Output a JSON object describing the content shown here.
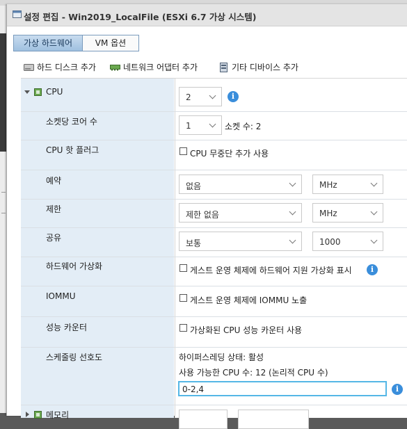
{
  "dialog": {
    "title": "설정 편집 - Win2019_LocalFile (ESXi 6.7 가상 시스템)"
  },
  "tabs": [
    {
      "label": "가상 하드웨어",
      "active": true
    },
    {
      "label": "VM 옵션",
      "active": false
    }
  ],
  "toolbar": {
    "add_disk": "하드 디스크 추가",
    "add_network": "네트워크 어댑터 추가",
    "add_other": "기타 디바이스 추가"
  },
  "cpu": {
    "label": "CPU",
    "count": "2",
    "cores_per_socket": {
      "label": "소켓당 코어 수",
      "value": "1",
      "sockets_text": "소켓 수: 2"
    },
    "hotplug": {
      "label": "CPU 핫 플러그",
      "option": "CPU 무중단 추가 사용",
      "checked": false
    },
    "reservation": {
      "label": "예약",
      "value": "없음",
      "unit": "MHz"
    },
    "limit": {
      "label": "제한",
      "value": "제한 없음",
      "unit": "MHz"
    },
    "shares": {
      "label": "공유",
      "value": "보통",
      "amount": "1000"
    },
    "hw_virtualization": {
      "label": "하드웨어 가상화",
      "option": "게스트 운영 체제에 하드웨어 지원 가상화 표시",
      "checked": false
    },
    "iommu": {
      "label": "IOMMU",
      "option": "게스트 운영 체제에 IOMMU 노출",
      "checked": false
    },
    "perf_counters": {
      "label": "성능 카운터",
      "option": "가상화된 CPU 성능 카운터 사용",
      "checked": false
    },
    "scheduling": {
      "label": "스케줄링 선호도",
      "hyperthreading": "하이퍼스레딩 상태: 활성",
      "available": "사용 가능한 CPU 수: 12 (논리적 CPU 수)",
      "value": "0-2,4"
    }
  },
  "memory": {
    "label": "메모리"
  },
  "colors": {
    "left_column": "#e3edf6",
    "focus_border": "#55b7e6",
    "info_icon": "#3a8edb"
  }
}
